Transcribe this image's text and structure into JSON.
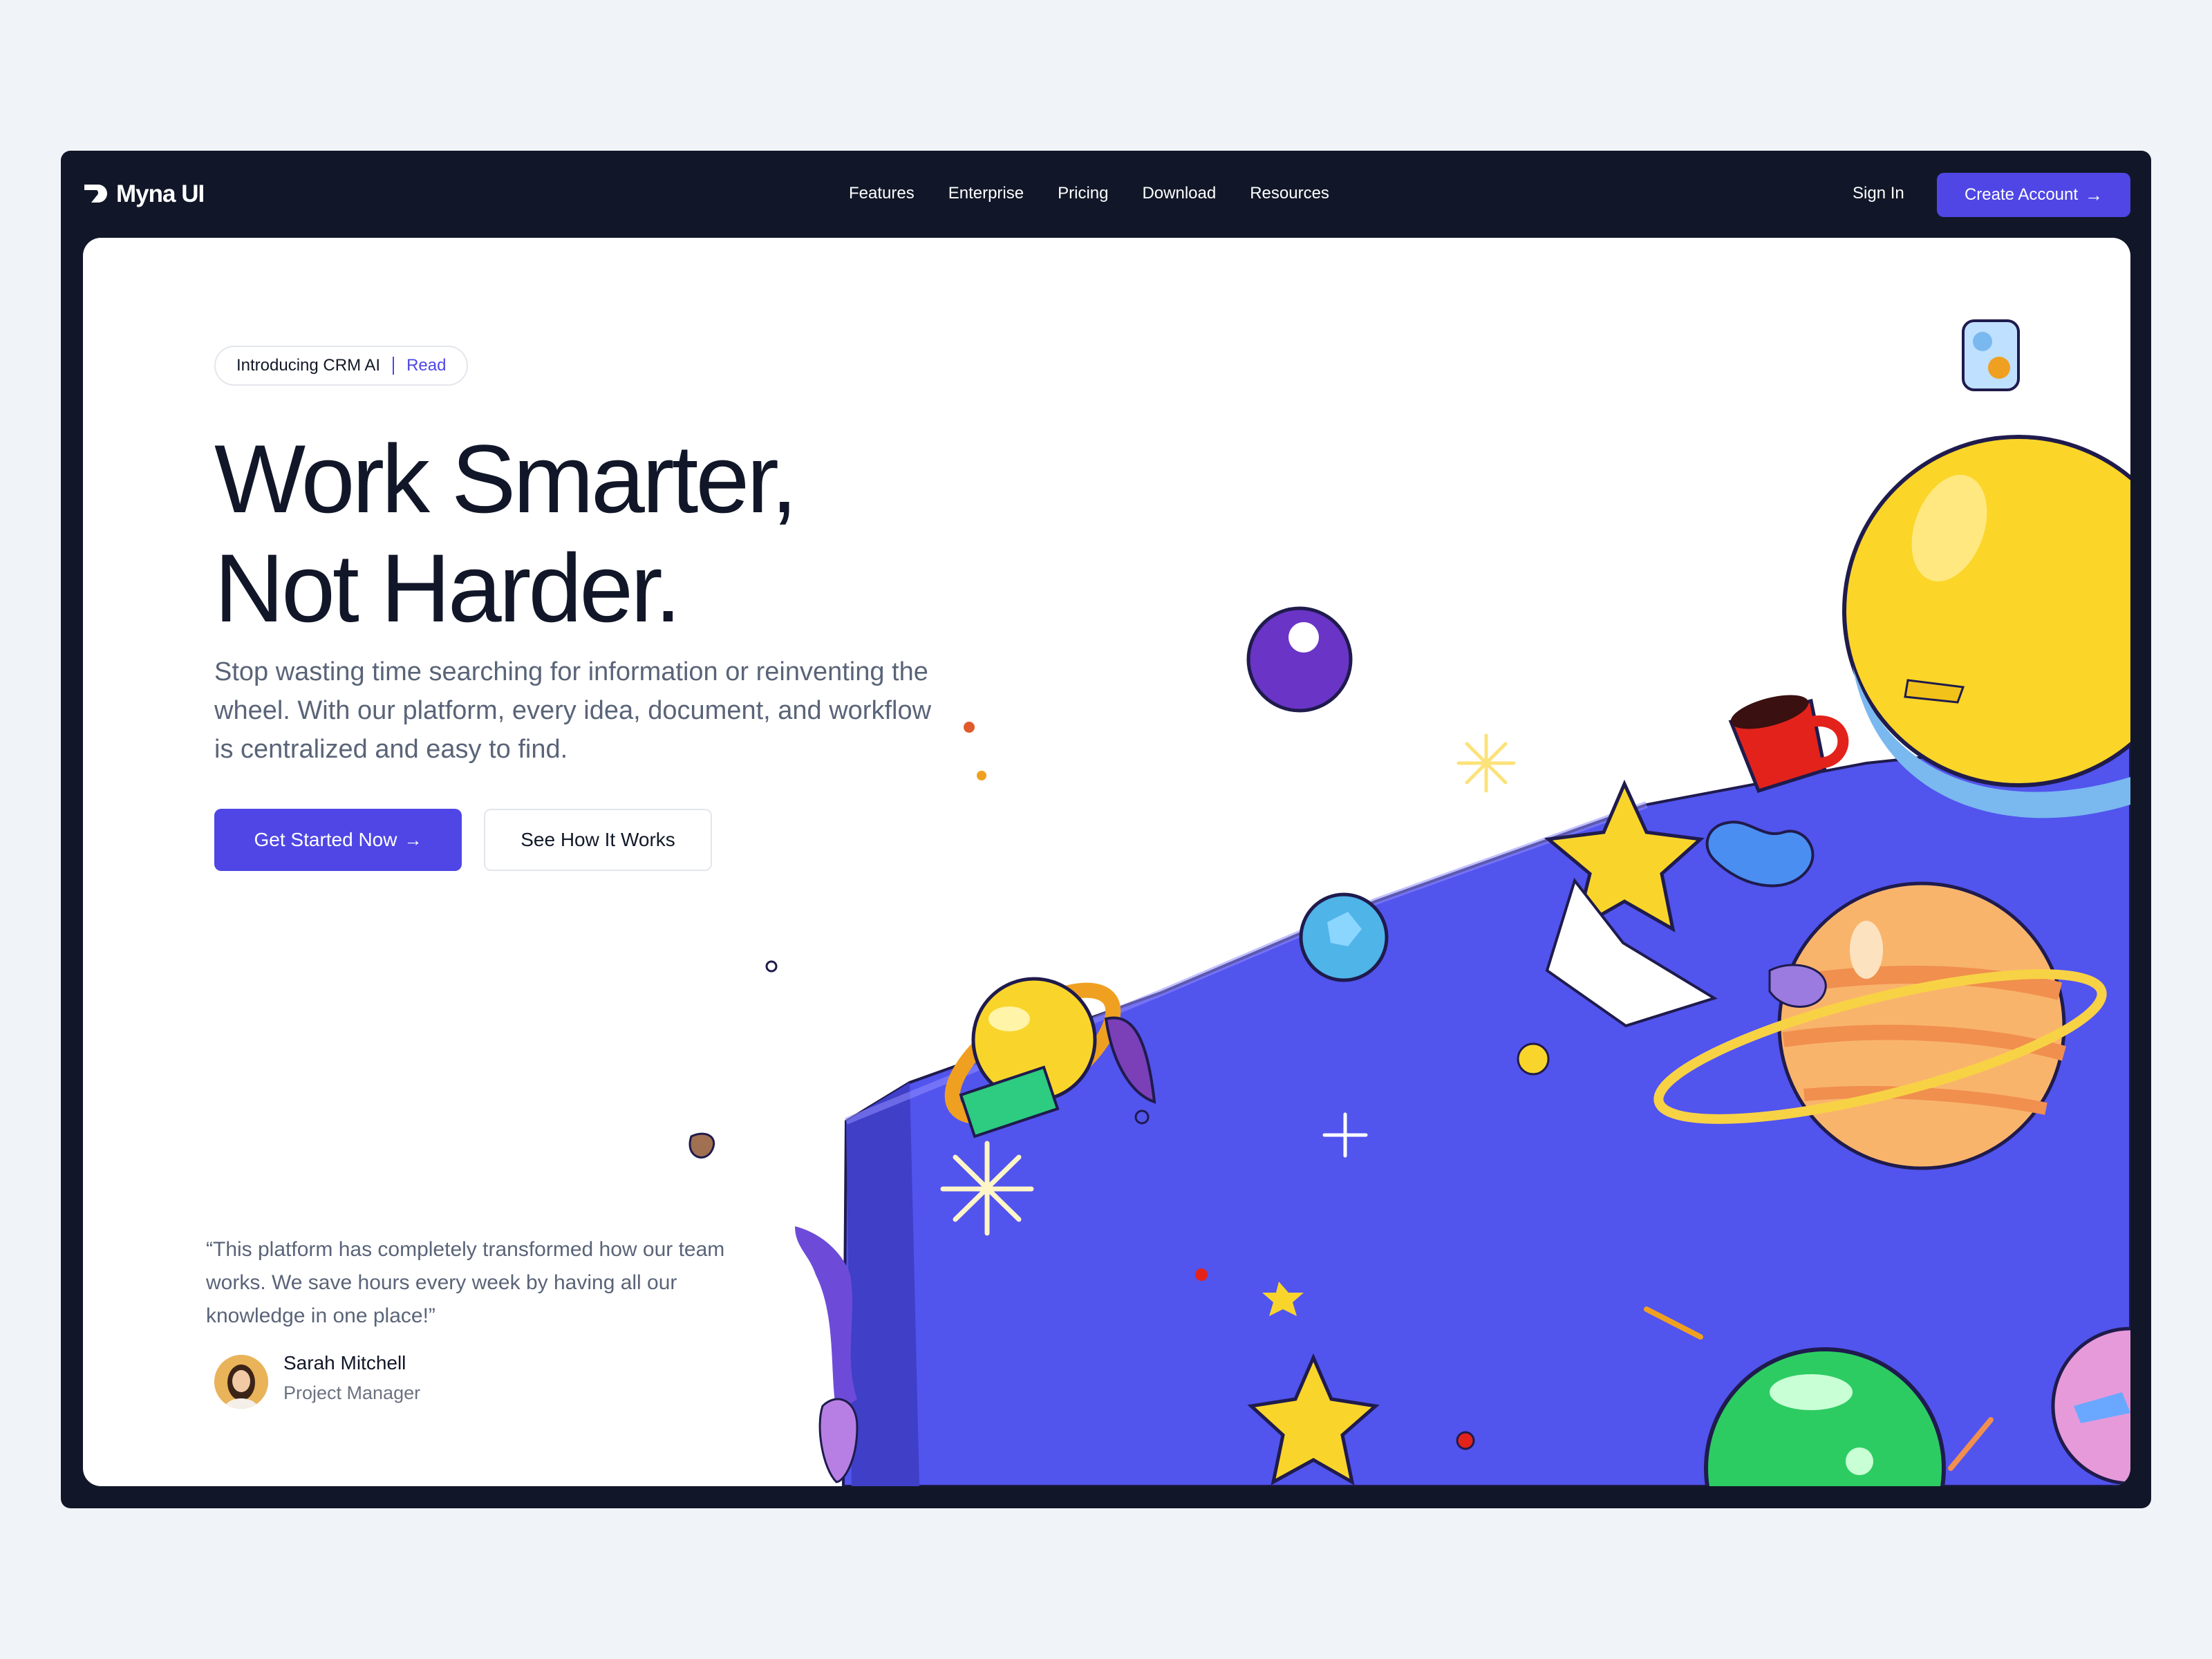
{
  "brand": {
    "name": "Myna UI"
  },
  "nav": {
    "links": [
      "Features",
      "Enterprise",
      "Pricing",
      "Download",
      "Resources"
    ],
    "sign_in": "Sign In",
    "create_account": "Create Account"
  },
  "hero": {
    "announcement": {
      "text": "Introducing CRM AI",
      "link": "Read"
    },
    "headline_line1": "Work Smarter,",
    "headline_line2": "Not Harder.",
    "subtext": "Stop wasting time searching for information or reinventing the wheel. With our platform, every idea, document, and workflow is centralized and easy to find.",
    "primary_cta": "Get Started Now",
    "secondary_cta": "See How It Works"
  },
  "testimonial": {
    "quote": "“This platform has completely transformed how our team works. We save hours every week by having all our knowledge in one place!”",
    "author_name": "Sarah Mitchell",
    "author_role": "Project Manager"
  },
  "colors": {
    "page_bg": "#f0f4f9",
    "frame_bg": "#111728",
    "accent": "#4f46e5",
    "heading": "#111728",
    "body_text": "#5a6478"
  },
  "icons": [
    "myna-logo-icon",
    "arrow-right-icon"
  ]
}
